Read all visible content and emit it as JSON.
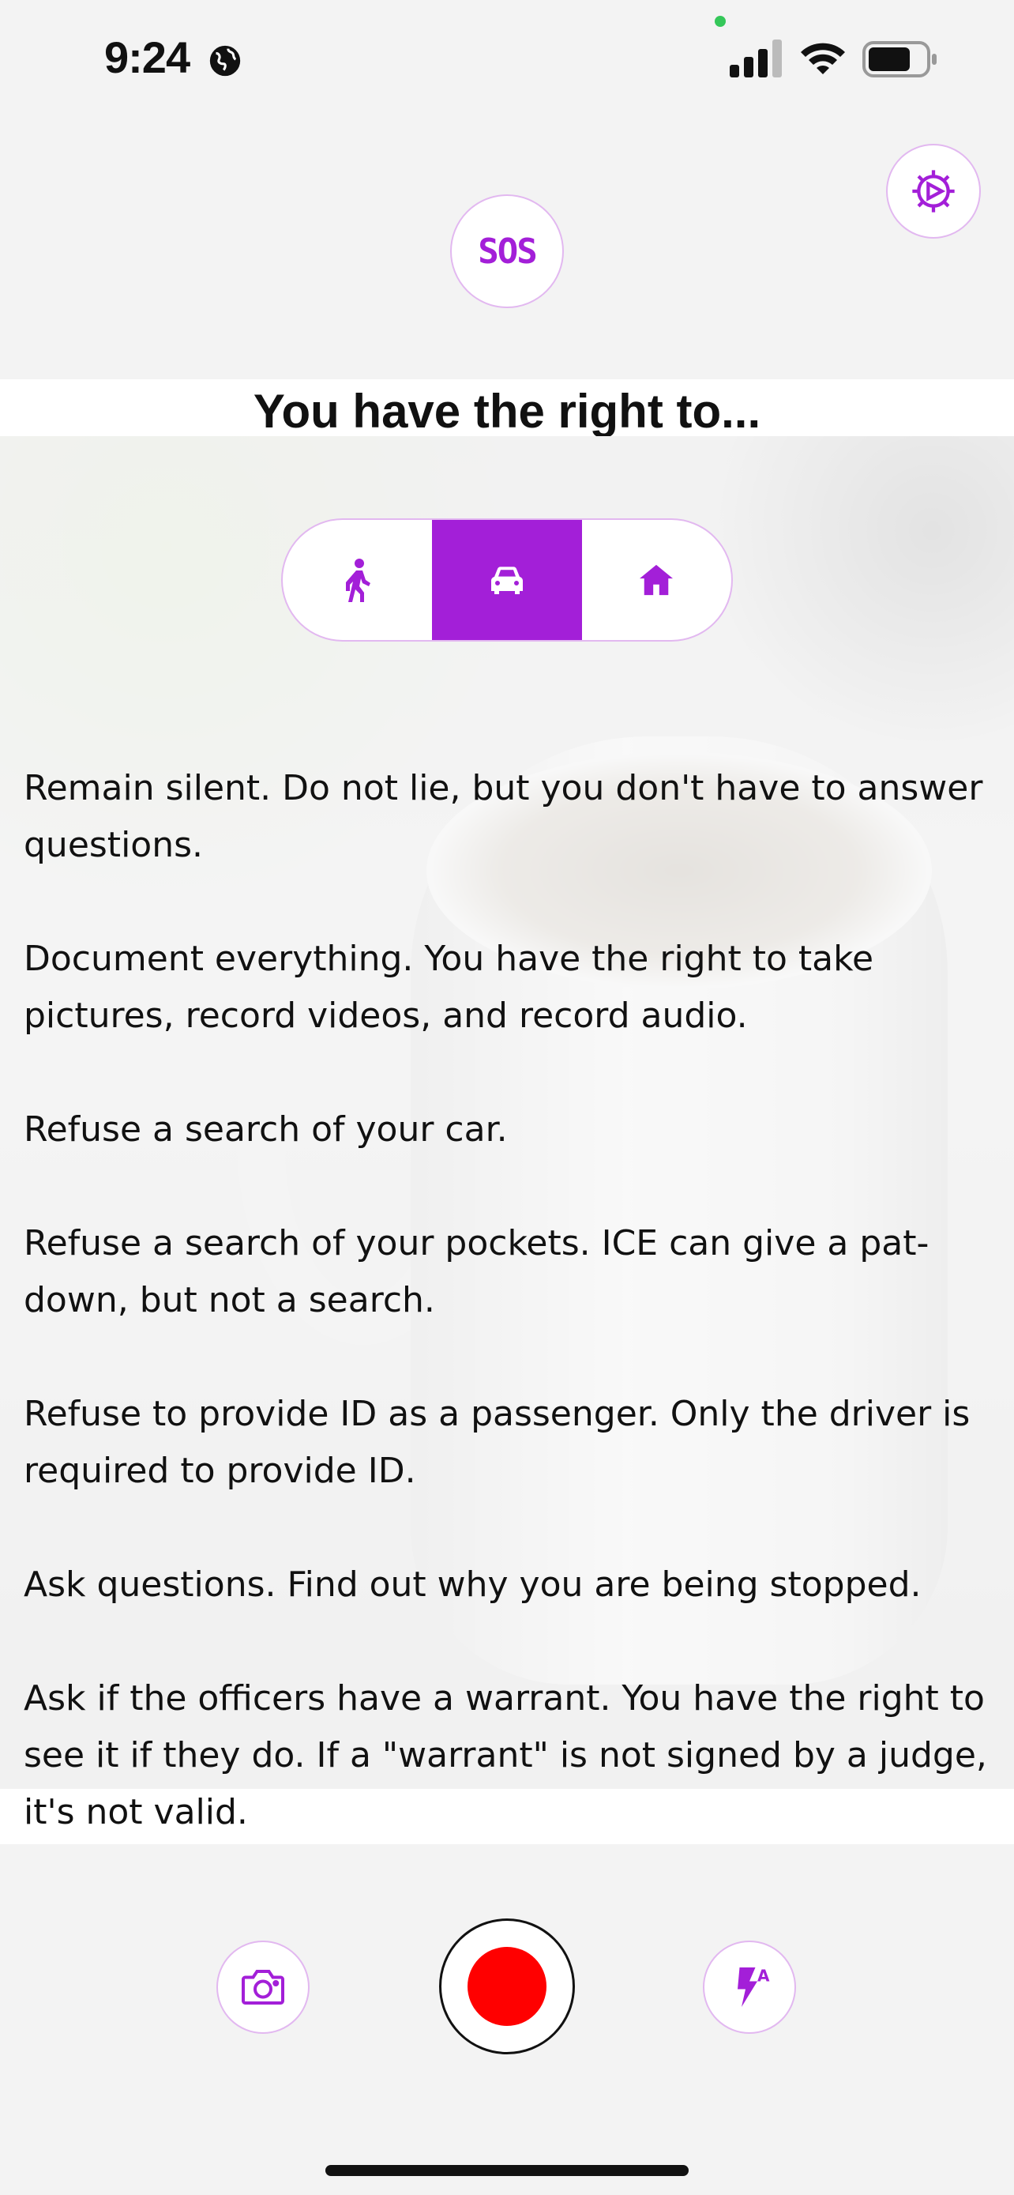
{
  "status_bar": {
    "time": "9:24"
  },
  "header": {
    "sos_label": "SOS"
  },
  "title": "You have the right to...",
  "tabs": [
    {
      "name": "walking",
      "icon": "person-walking-icon",
      "active": false
    },
    {
      "name": "car",
      "icon": "car-icon",
      "active": true
    },
    {
      "name": "home",
      "icon": "house-icon",
      "active": false
    }
  ],
  "rights": [
    "Remain silent. Do not lie, but you don't have to answer questions.",
    "Document everything. You have the right to take pictures, record videos, and record audio.",
    "Refuse a search of your car.",
    "Refuse a search of your pockets. ICE can give a pat-down, but not a search.",
    "Refuse to provide ID as a passenger. Only the driver is required to provide ID.",
    "Ask questions. Find out why you are being stopped.",
    "Ask if the officers have a warrant. You have the right to see it if they do. If a \"warrant\" is not signed by a judge, it's not valid."
  ],
  "colors": {
    "accent": "#a31fd8",
    "record": "#ff0000",
    "border": "#e2b8f0"
  }
}
